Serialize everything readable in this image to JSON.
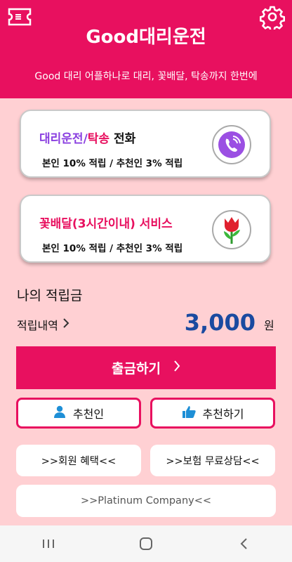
{
  "header": {
    "title": "Good대리운전",
    "subtitle": "Good 대리 어플하나로 대리, 꽃배달, 탁송까지 한번에",
    "left_icon": "ticket-icon",
    "right_icon": "gear-icon"
  },
  "cards": [
    {
      "title_part1": "대리운전",
      "title_slash": "/",
      "title_part2": "탁송",
      "title_part3": " 전화",
      "subtitle": "본인 10% 적립 / 추천인 3% 적립",
      "icon": "phone-icon",
      "colors": {
        "part1": "#8a3fe0",
        "part2": "#e8105f",
        "part3": "#111111"
      }
    },
    {
      "title": "꽃배달(3시간이내) 서비스",
      "subtitle": "본인 10% 적립 / 추천인 3% 적립",
      "icon": "tulip-icon",
      "color": "#e8105f"
    }
  ],
  "savings": {
    "label": "나의 적립금",
    "history_label": "적립내역",
    "amount": "3,000",
    "unit": "원"
  },
  "buttons": {
    "withdraw": "출금하기",
    "recommender": "추천인",
    "recommend": "추천하기",
    "member_benefits": ">>회원 혜택<<",
    "insurance": ">>보험 무료상담<<",
    "platinum": ">>Platinum Company<<"
  },
  "colors": {
    "accent": "#e8105f",
    "background": "#ffd0d3",
    "amount": "#1a4aa0",
    "icon_blue": "#1e8fd6"
  },
  "navbar": {
    "icons": [
      "recent-apps-icon",
      "home-icon",
      "back-icon"
    ]
  }
}
